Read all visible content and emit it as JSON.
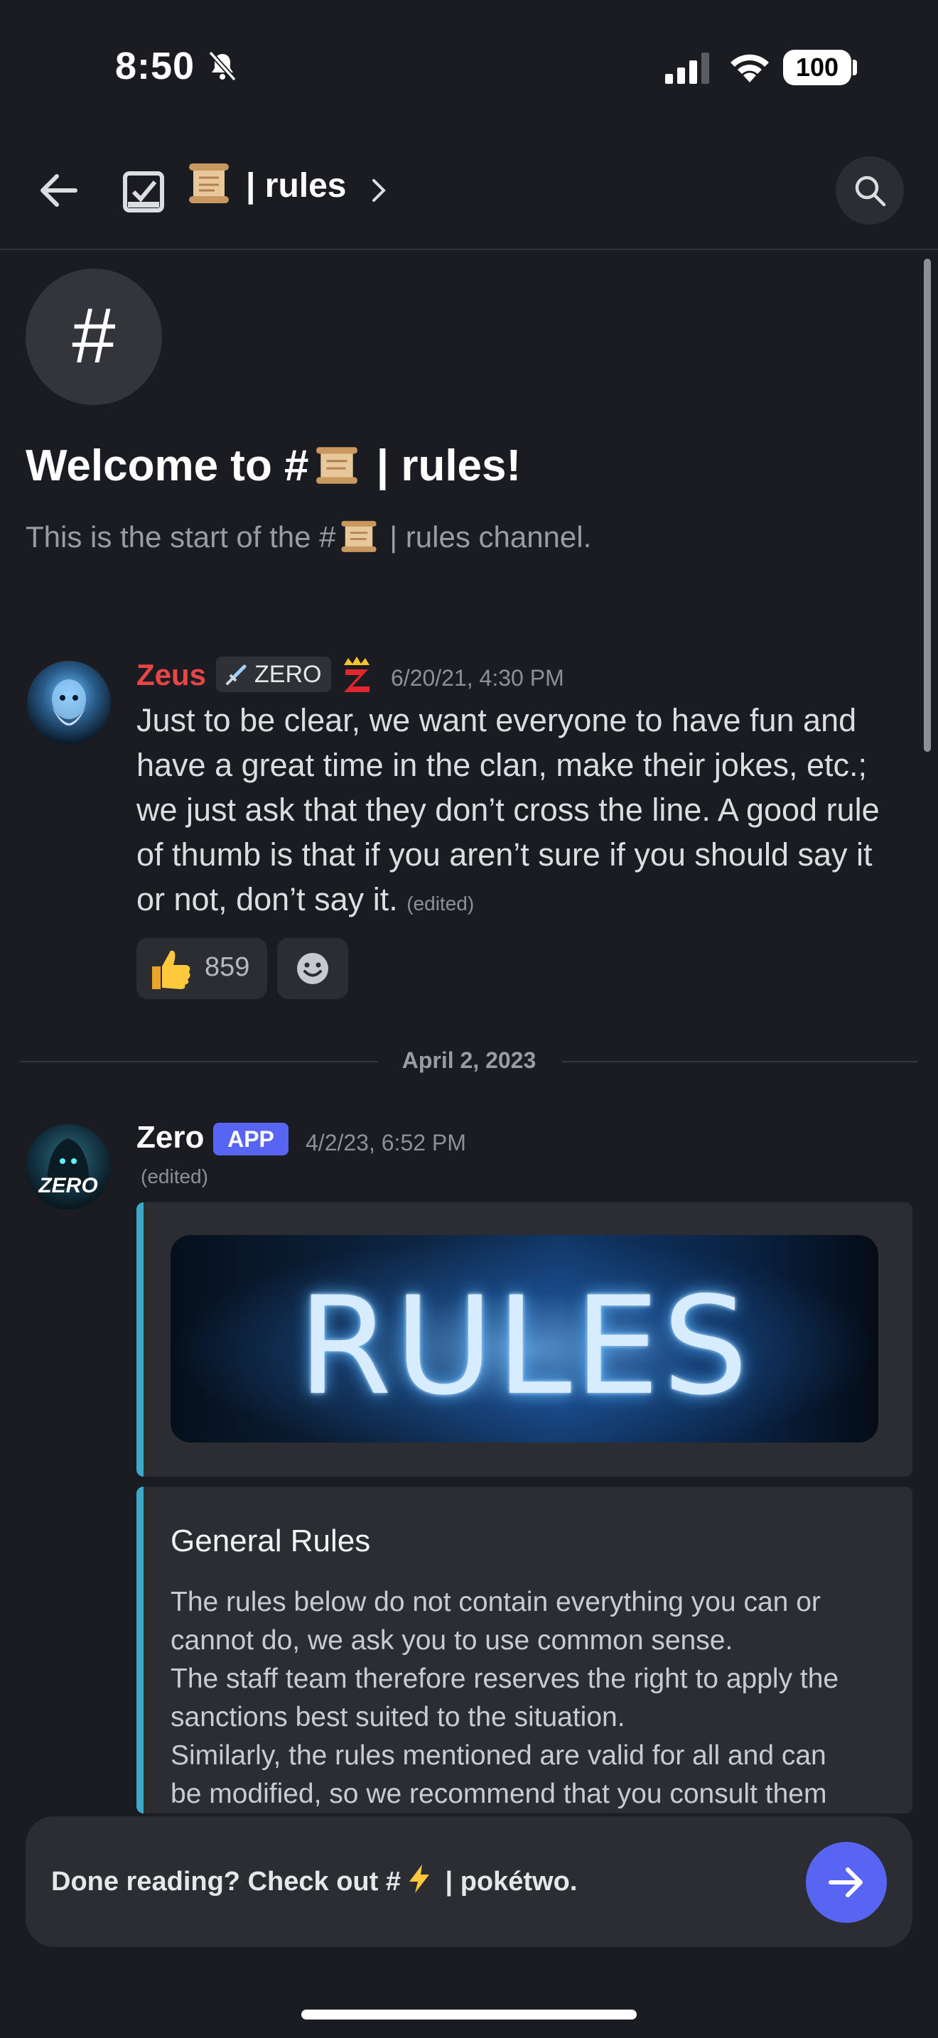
{
  "status_bar": {
    "time": "8:50",
    "battery": "100"
  },
  "header": {
    "title": "| rules",
    "scroll_icon": "scroll-icon"
  },
  "welcome": {
    "title_prefix": "Welcome to #",
    "title_suffix": " | rules!",
    "subtitle_prefix": "This is the start of the #",
    "subtitle_suffix": " | rules channel.",
    "hash": "#"
  },
  "messages": [
    {
      "author": "Zeus",
      "tag": "ZERO",
      "timestamp": "6/20/21, 4:30 PM",
      "text": "Just to be clear, we want everyone to have fun and have a great time in the clan, make their jokes, etc.; we just ask that they don’t cross the line. A good rule of thumb is that if you aren’t sure if you should say it or not, don’t say it.",
      "edited": "(edited)",
      "reaction_count": "859",
      "author_color": "#e84545"
    },
    {
      "author": "Zero",
      "badge": "APP",
      "timestamp": "4/2/23, 6:52 PM",
      "edited": "(edited)",
      "avatar_text": "ZERO",
      "banner_text": "RULES",
      "embed_title": "General Rules",
      "embed_lines": [
        "The rules below do not contain everything you can or",
        "cannot do, we ask you to use common sense.",
        "The staff team therefore reserves the right to apply the",
        "sanctions best suited to the situation.",
        "Similarly, the rules mentioned are valid for all and can",
        "be modified, so we recommend that you consult them"
      ]
    }
  ],
  "date_divider": "April 2, 2023",
  "bottom": {
    "prefix": "Done reading? Check out #",
    "suffix": " | pokétwo."
  },
  "colors": {
    "accent": "#5865f2",
    "embed_bar": "#3ea8c9",
    "background": "#1b1c21"
  }
}
